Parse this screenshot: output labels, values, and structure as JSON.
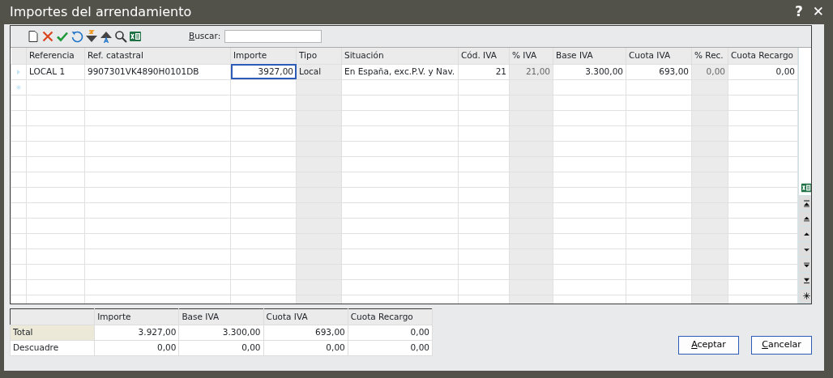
{
  "window": {
    "title": "Importes del arrendamiento",
    "controls": [
      "?",
      "✕"
    ]
  },
  "toolbar": {
    "search": {
      "label": "Buscar:",
      "underline_first": true
    }
  },
  "grid": {
    "columns": [
      {
        "label": "Referencia",
        "kind": "text",
        "readonly": false
      },
      {
        "label": "Ref. catastral",
        "kind": "text",
        "readonly": false
      },
      {
        "label": "Importe",
        "kind": "number",
        "readonly": false
      },
      {
        "label": "Tipo",
        "kind": "text",
        "readonly": true
      },
      {
        "label": "Situación",
        "kind": "text",
        "readonly": false
      },
      {
        "label": "Cód. IVA",
        "kind": "number",
        "readonly": false
      },
      {
        "label": "% IVA",
        "kind": "number",
        "readonly": true
      },
      {
        "label": "Base IVA",
        "kind": "number",
        "readonly": false
      },
      {
        "label": "Cuota IVA",
        "kind": "number",
        "readonly": false
      },
      {
        "label": "% Rec.",
        "kind": "number",
        "readonly": true
      },
      {
        "label": "Cuota Recargo",
        "kind": "number",
        "readonly": false
      }
    ],
    "rows": [
      {
        "current": true,
        "cells": [
          {
            "text": "LOCAL 1",
            "focused": false
          },
          {
            "text": "9907301VK4890H0101DB",
            "focused": false
          },
          {
            "text": "3927,00",
            "focused": true
          },
          {
            "text": "Local",
            "focused": false
          },
          {
            "text": "En España, exc.P.V. y Nav.",
            "focused": false
          },
          {
            "text": "21",
            "focused": false
          },
          {
            "text": "21,00",
            "focused": false
          },
          {
            "text": "3.300,00",
            "focused": false
          },
          {
            "text": "693,00",
            "focused": false
          },
          {
            "text": "0,00",
            "focused": false
          },
          {
            "text": "0,00",
            "focused": false
          }
        ]
      }
    ]
  },
  "totals": {
    "columns": [
      "Importe",
      "Base IVA",
      "Cuota IVA",
      "Cuota Recargo"
    ],
    "rows": [
      {
        "label": "Total",
        "selected": true,
        "values": [
          "3.927,00",
          "3.300,00",
          "693,00",
          "0,00"
        ]
      },
      {
        "label": "Descuadre",
        "selected": false,
        "values": [
          "0,00",
          "0,00",
          "0,00",
          "0,00"
        ]
      }
    ]
  },
  "buttons": [
    {
      "label": "Aceptar",
      "underline_first": true
    },
    {
      "label": "Cancelar",
      "underline_first": true
    }
  ]
}
